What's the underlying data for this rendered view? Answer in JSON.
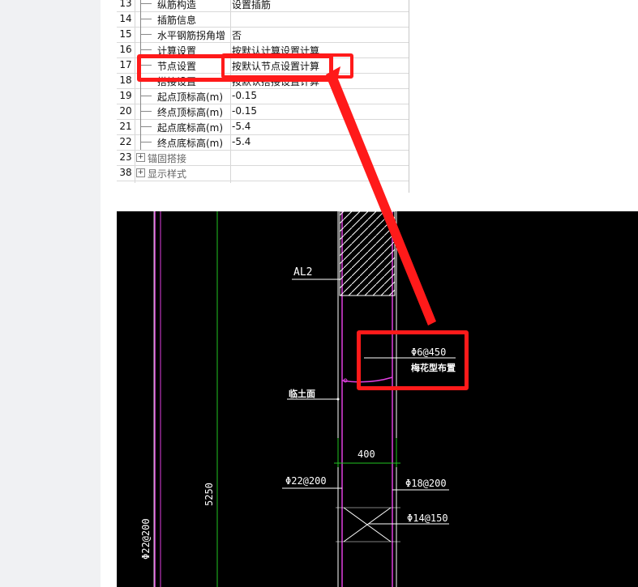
{
  "property_table": {
    "rows": [
      {
        "num": "13",
        "name": "纵筋构造",
        "value": "设置插筋",
        "type": "child"
      },
      {
        "num": "14",
        "name": "插筋信息",
        "value": "",
        "type": "child"
      },
      {
        "num": "15",
        "name": "水平钢筋拐角增",
        "value": "否",
        "type": "child"
      },
      {
        "num": "16",
        "name": "计算设置",
        "value": "按默认计算设置计算",
        "type": "child"
      },
      {
        "num": "17",
        "name": "节点设置",
        "value": "按默认节点设置计算",
        "type": "child"
      },
      {
        "num": "18",
        "name": "搭接设置",
        "value": "按默认搭接设置计算",
        "type": "child"
      },
      {
        "num": "19",
        "name": "起点顶标高(m)",
        "value": "-0.15",
        "type": "child"
      },
      {
        "num": "20",
        "name": "终点顶标高(m)",
        "value": "-0.15",
        "type": "child"
      },
      {
        "num": "21",
        "name": "起点底标高(m)",
        "value": "-5.4",
        "type": "child"
      },
      {
        "num": "22",
        "name": "终点底标高(m)",
        "value": "-5.4",
        "type": "child"
      },
      {
        "num": "23",
        "name": "锚固搭接",
        "value": "",
        "type": "group"
      },
      {
        "num": "38",
        "name": "显示样式",
        "value": "",
        "type": "group"
      }
    ],
    "expander_symbol": "+"
  },
  "cad_drawing": {
    "beam_label": "AL2",
    "highlighted_rebar": "Φ6@450",
    "highlighted_note": "梅花型布置",
    "soil_face_label": "临土面",
    "wall_thickness": "400",
    "rebar_left": "Φ22@200",
    "rebar_right": "Φ18@200",
    "rebar_tie": "Φ14@150",
    "vertical_dimension": "5250",
    "rebar_vertical": "Φ22@200"
  },
  "colors": {
    "highlight": "#ff1a1a",
    "cad_background": "#000000",
    "cad_wall_line": "#e040e0",
    "cad_dim_line": "#22c322",
    "cad_text": "#ffffff"
  }
}
